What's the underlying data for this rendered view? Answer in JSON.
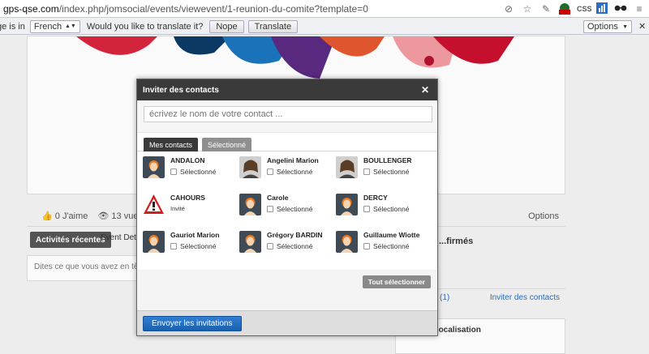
{
  "browser": {
    "url_domain": "gps-qse.com",
    "url_path": "/index.php/jomsocial/events/viewevent/1-reunion-du-comite?template=0",
    "ext_css_label": "CSS",
    "ext_new_badge": "New"
  },
  "translate_bar": {
    "prefix": "ge is in",
    "language": "French",
    "question": "Would you like to translate it?",
    "nope_label": "Nope",
    "translate_label": "Translate",
    "options_label": "Options"
  },
  "event": {
    "likes": "0 J'aime",
    "views": "13 vues",
    "options": "Options",
    "tab_recent": "Activités récentes",
    "tab_details": "Event Details",
    "status_placeholder": "Dites ce que vous avez en tête...",
    "confirmed_title": "...firmés",
    "confirmed_count": "(1)",
    "invite_link": "Inviter des contacts",
    "map_title": "Carte de localisation"
  },
  "modal": {
    "title": "Inviter des contacts",
    "search_placeholder": "écrivez le nom de votre contact ...",
    "tab_contacts": "Mes contacts",
    "tab_selected": "Sélectionné",
    "select_all": "Tout sélectionner",
    "send_label": "Envoyer les invitations",
    "contacts": [
      {
        "name": "ANDALON",
        "status": "Sélectionné",
        "avatar": "default-avatar",
        "invited": false
      },
      {
        "name": "Angelini Marion",
        "status": "Sélectionné",
        "avatar": "photo-avatar",
        "invited": false
      },
      {
        "name": "BOULLENGER",
        "status": "Sélectionné",
        "avatar": "photo-avatar",
        "invited": false
      },
      {
        "name": "CAHOURS",
        "status": "Invité",
        "avatar": "warning-icon",
        "invited": true
      },
      {
        "name": "Carole",
        "status": "Sélectionné",
        "avatar": "default-avatar",
        "invited": false
      },
      {
        "name": "DERCY",
        "status": "Sélectionné",
        "avatar": "default-avatar",
        "invited": false
      },
      {
        "name": "Gauriot Marion",
        "status": "Sélectionné",
        "avatar": "default-avatar",
        "invited": false
      },
      {
        "name": "Grégory BARDIN",
        "status": "Sélectionné",
        "avatar": "default-avatar",
        "invited": false
      },
      {
        "name": "Guillaume Wiotte",
        "status": "Sélectionné",
        "avatar": "default-avatar",
        "invited": false
      }
    ]
  }
}
